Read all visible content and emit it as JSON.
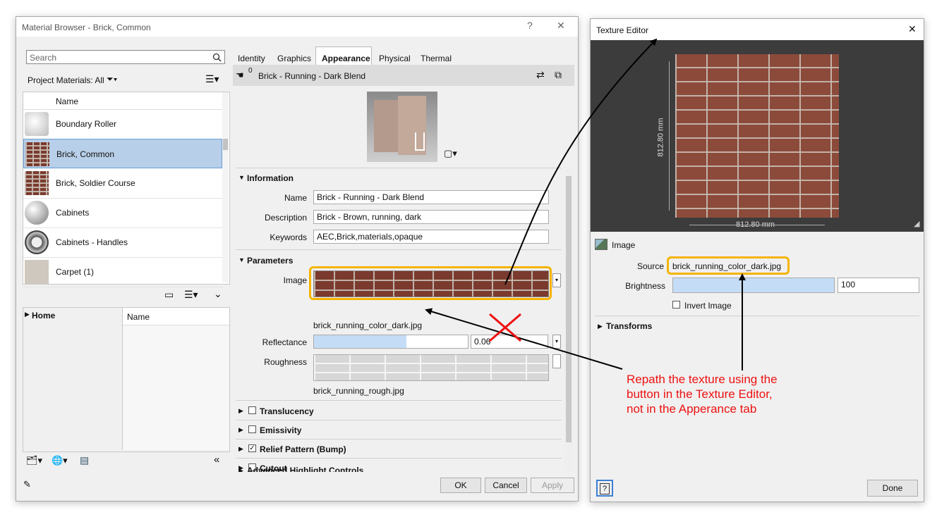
{
  "material_browser": {
    "title": "Material Browser - Brick, Common",
    "help_glyph": "?",
    "close_glyph": "✕",
    "search_placeholder": "Search",
    "filter_label": "Project Materials: All",
    "list_header": "Name",
    "materials": [
      {
        "name": "Boundary Roller"
      },
      {
        "name": "Brick, Common",
        "selected": true
      },
      {
        "name": "Brick, Soldier Course"
      },
      {
        "name": "Cabinets"
      },
      {
        "name": "Cabinets - Handles"
      },
      {
        "name": "Carpet (1)"
      }
    ],
    "library_home": "Home",
    "library_header": "Name"
  },
  "editor": {
    "tabs": [
      "Identity",
      "Graphics",
      "Appearance",
      "Physical",
      "Thermal"
    ],
    "active_tab": "Appearance",
    "asset_count": "0",
    "asset_name": "Brick - Running - Dark Blend",
    "information": {
      "heading": "Information",
      "name_label": "Name",
      "name_value": "Brick - Running - Dark Blend",
      "description_label": "Description",
      "description_value": "Brick - Brown, running, dark",
      "keywords_label": "Keywords",
      "keywords_value": "AEC,Brick,materials,opaque"
    },
    "parameters": {
      "heading": "Parameters",
      "image_label": "Image",
      "image_file": "brick_running_color_dark.jpg",
      "reflectance_label": "Reflectance",
      "reflectance_value": "0.06",
      "reflectance_level": 0.6,
      "roughness_label": "Roughness",
      "roughness_file": "brick_running_rough.jpg"
    },
    "sections": [
      {
        "label": "Translucency",
        "checked": false
      },
      {
        "label": "Emissivity",
        "checked": false
      },
      {
        "label": "Relief Pattern (Bump)",
        "checked": true
      },
      {
        "label": "Cutout",
        "checked": false
      }
    ],
    "advanced_label": "Advanced Highlight Controls",
    "buttons": {
      "ok": "OK",
      "cancel": "Cancel",
      "apply": "Apply"
    }
  },
  "texture_editor": {
    "title": "Texture Editor",
    "close_glyph": "✕",
    "dim_vertical": "812.80 mm",
    "dim_horizontal": "812.80 mm",
    "image_heading": "Image",
    "source_label": "Source",
    "source_value": "brick_running_color_dark.jpg",
    "brightness_label": "Brightness",
    "brightness_value": "100",
    "invert_label": "Invert Image",
    "transforms_label": "Transforms",
    "help_glyph": "?",
    "done_label": "Done"
  },
  "annotation": {
    "lines": [
      "Repath the texture using the",
      "button in the Texture Editor,",
      "not in the Apperance tab"
    ],
    "color": "#e11111",
    "highlight_color": "#f5b400"
  }
}
